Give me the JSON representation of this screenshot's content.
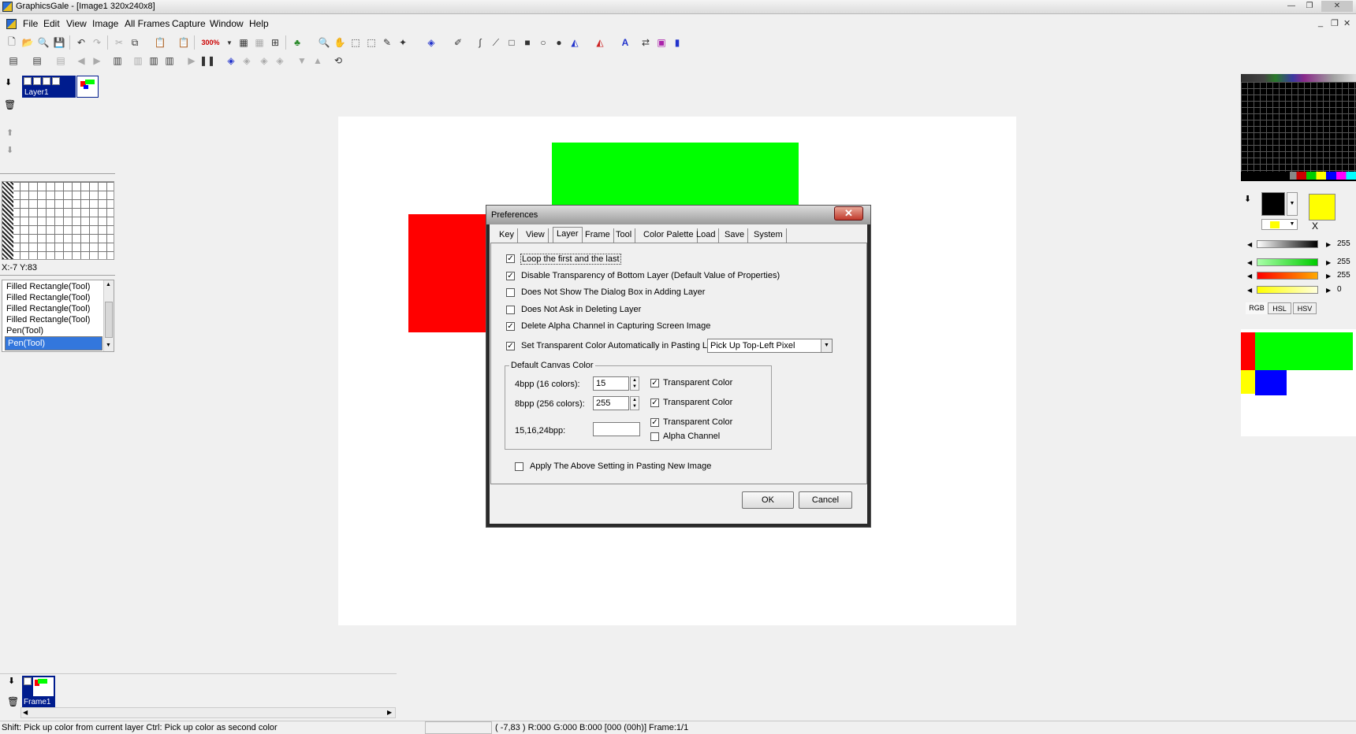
{
  "window": {
    "title": "GraphicsGale - [Image1 320x240x8]"
  },
  "menu": [
    "File",
    "Edit",
    "View",
    "Image",
    "All Frames",
    "Capture",
    "Window",
    "Help"
  ],
  "toolbar": {
    "zoom": "300%"
  },
  "layer_panel": {
    "layer_name": "Layer1",
    "coords": "X:-7 Y:83"
  },
  "history": [
    "Filled Rectangle(Tool)",
    "Filled Rectangle(Tool)",
    "Filled Rectangle(Tool)",
    "Filled Rectangle(Tool)",
    "Pen(Tool)",
    "Pen(Tool)"
  ],
  "frame_panel": {
    "frame_name": "Frame1"
  },
  "dialog": {
    "title": "Preferences",
    "close": "✕",
    "tabs": [
      "Key",
      "View",
      "Layer",
      "Frame",
      "Tool",
      "Color Palette",
      "Load",
      "Save",
      "System"
    ],
    "active_tab": "Layer",
    "options": [
      {
        "label": "Loop the first and the last",
        "checked": true
      },
      {
        "label": "Disable Transparency of Bottom Layer (Default Value of Properties)",
        "checked": true
      },
      {
        "label": "Does Not Show The Dialog Box in Adding Layer",
        "checked": false
      },
      {
        "label": "Does Not Ask in Deleting Layer",
        "checked": false
      },
      {
        "label": "Delete Alpha Channel in Capturing Screen Image",
        "checked": true
      },
      {
        "label": "Set Transparent Color Automatically in Pasting Layer",
        "checked": true
      }
    ],
    "paste_mode": "Pick Up Top-Left Pixel",
    "group_title": "Default Canvas Color",
    "bpp4_label": "4bpp (16 colors):",
    "bpp4_value": "15",
    "bpp8_label": "8bpp (256 colors):",
    "bpp8_value": "255",
    "bpp24_label": "15,16,24bpp:",
    "transparent_label": "Transparent Color",
    "alpha_label": "Alpha Channel",
    "apply_label": "Apply The Above Setting in Pasting New Image",
    "ok": "OK",
    "cancel": "Cancel"
  },
  "color_panel": {
    "v_gray": "255",
    "v_r": "255",
    "v_g": "255",
    "v_b": "0",
    "tabs": [
      "RGB",
      "HSL",
      "HSV"
    ],
    "x_label": "X"
  },
  "status": {
    "left": "Shift: Pick up color from current layer  Ctrl: Pick up color as second color",
    "right": "( -7,83 ) R:000 G:000 B:000  [000 (00h)]  Frame:1/1"
  },
  "colors": {
    "red": "#ff0000",
    "green": "#00ff00",
    "blue": "#0000ff",
    "yellow": "#ffff00",
    "selection": "#3377dd"
  }
}
